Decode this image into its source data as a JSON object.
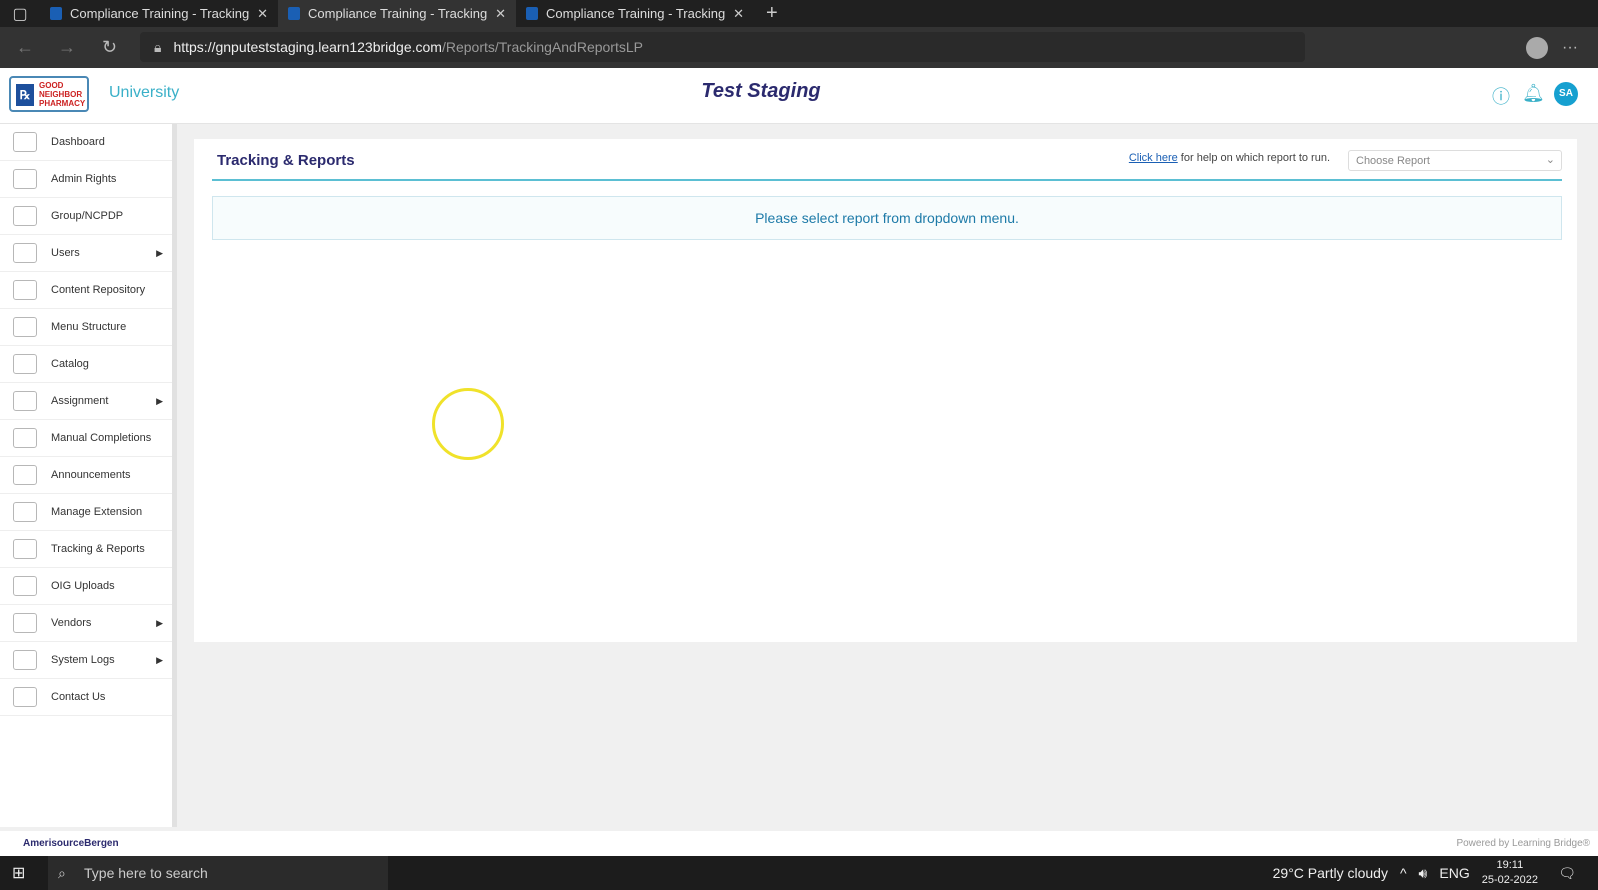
{
  "browser": {
    "tabs": [
      {
        "title": "Compliance Training - Tracking &"
      },
      {
        "title": "Compliance Training - Tracking &"
      },
      {
        "title": "Compliance Training - Tracking &"
      }
    ],
    "url_domain": "https://gnputeststaging.learn123bridge.com",
    "url_path": "/Reports/TrackingAndReportsLP"
  },
  "header": {
    "logo_text": "Good Neighbor Pharmacy",
    "university": "University",
    "title": "Test Staging",
    "avatar": "SA"
  },
  "sidebar": {
    "items": [
      {
        "label": "Dashboard"
      },
      {
        "label": "Admin Rights"
      },
      {
        "label": "Group/NCPDP"
      },
      {
        "label": "Users",
        "arrow": true
      },
      {
        "label": "Content Repository"
      },
      {
        "label": "Menu Structure"
      },
      {
        "label": "Catalog"
      },
      {
        "label": "Assignment",
        "arrow": true
      },
      {
        "label": "Manual Completions"
      },
      {
        "label": "Announcements"
      },
      {
        "label": "Manage Extension"
      },
      {
        "label": "Tracking & Reports"
      },
      {
        "label": "OIG Uploads"
      },
      {
        "label": "Vendors",
        "arrow": true
      },
      {
        "label": "System Logs",
        "arrow": true
      },
      {
        "label": "Contact Us"
      }
    ]
  },
  "main": {
    "heading": "Tracking & Reports",
    "help_link": "Click here",
    "help_text": " for help on which report to run.",
    "select_value": "Choose Report",
    "message": "Please select report from dropdown menu."
  },
  "footer": {
    "left": "AmerisourceBergen",
    "right": "Powered by Learning Bridge®"
  },
  "taskbar": {
    "search_placeholder": "Type here to search",
    "weather": "29°C  Partly cloudy",
    "lang": "ENG",
    "time": "19:11",
    "date": "25-02-2022"
  }
}
